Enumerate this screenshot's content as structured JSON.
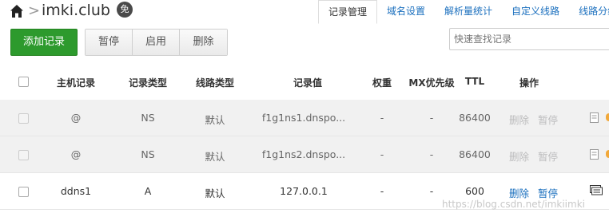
{
  "header": {
    "domain": "imki.club",
    "separator": ">",
    "badge": "免"
  },
  "tabs": [
    {
      "label": "记录管理",
      "active": true
    },
    {
      "label": "域名设置",
      "active": false
    },
    {
      "label": "解析量统计",
      "active": false
    },
    {
      "label": "自定义线路",
      "active": false
    },
    {
      "label": "线路分组",
      "active": false
    }
  ],
  "toolbar": {
    "add_label": "添加记录",
    "pause_label": "暂停",
    "enable_label": "启用",
    "delete_label": "删除",
    "search_placeholder": "快速查找记录"
  },
  "table": {
    "headers": {
      "host": "主机记录",
      "type": "记录类型",
      "line": "线路类型",
      "value": "记录值",
      "weight": "权重",
      "mx": "MX优先级",
      "ttl": "TTL",
      "ops": "操作"
    },
    "rows": [
      {
        "host": "@",
        "type": "NS",
        "line": "默认",
        "value": "f1g1ns1.dnspo...",
        "weight": "-",
        "mx": "-",
        "ttl": "86400",
        "del": "删除",
        "pause": "暂停",
        "disabled": true
      },
      {
        "host": "@",
        "type": "NS",
        "line": "默认",
        "value": "f1g1ns2.dnspo...",
        "weight": "-",
        "mx": "-",
        "ttl": "86400",
        "del": "删除",
        "pause": "暂停",
        "disabled": true
      },
      {
        "host": "ddns1",
        "type": "A",
        "line": "默认",
        "value": "127.0.0.1",
        "weight": "-",
        "mx": "-",
        "ttl": "600",
        "del": "删除",
        "pause": "暂停",
        "disabled": false
      }
    ]
  },
  "watermark": "https://blog.csdn.net/imkiimki",
  "colors": {
    "add_button": "#2d9a2d",
    "link": "#1a6fbe",
    "disabled_row": "#f1f1f1",
    "status_dot": "#f1a83a"
  }
}
